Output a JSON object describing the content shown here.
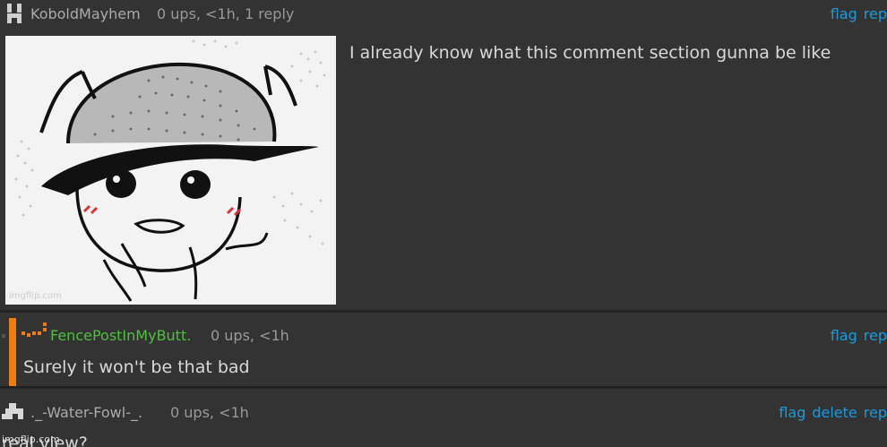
{
  "comments": [
    {
      "username": "KoboldMayhem",
      "meta": "0 ups, <1h, 1 reply",
      "actions": [
        "flag",
        "rep"
      ],
      "text": "I already know what this comment section gunna be like",
      "image_watermark": "imgflip.com",
      "avatar_icon": "kobold-pixel-avatar-icon"
    },
    {
      "username": "FencePostInMyButt.",
      "username_color": "#4fbf3f",
      "meta": "0 ups, <1h",
      "actions": [
        "flag",
        "rep"
      ],
      "text": "Surely it won't be that bad",
      "avatar_icon": "fence-pixel-avatar-icon"
    },
    {
      "username": "._-Water-Fowl-_.",
      "meta": "0 ups, <1h",
      "actions": [
        "flag",
        "delete",
        "rep"
      ],
      "text": "real view?",
      "avatar_icon": "duck-pixel-avatar-icon"
    }
  ],
  "footer_watermark": "imgflip.com",
  "colors": {
    "background": "#333333",
    "link": "#1c9ad8",
    "reply_bar": "#f07c10"
  }
}
